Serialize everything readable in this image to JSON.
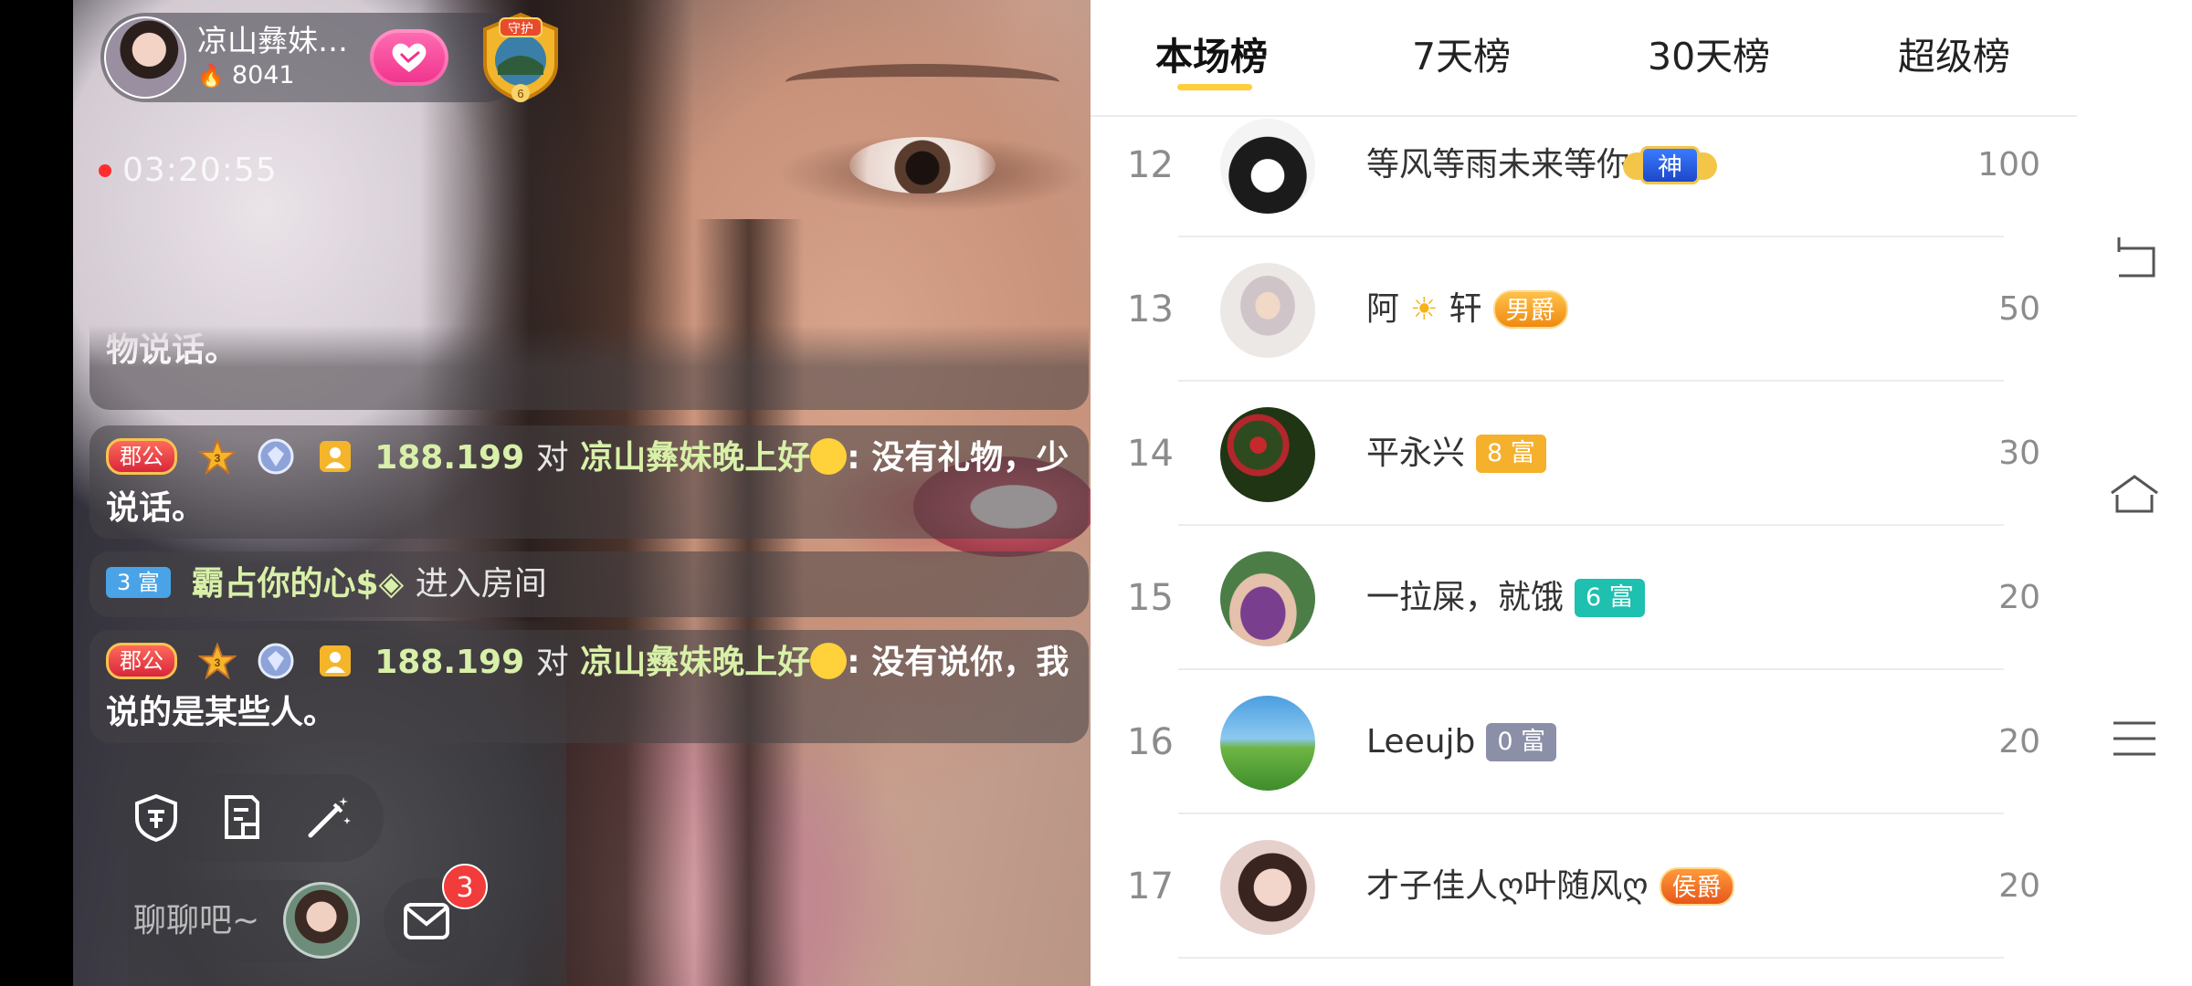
{
  "stream": {
    "host": {
      "name": "凉山彝妹…",
      "fans": "8041"
    },
    "guard_badge_text": "守护",
    "guard_badge_number": "6",
    "timer": "03:20:55",
    "chat": [
      {
        "tail": "物说话。"
      },
      {
        "tag": "郡公",
        "user": "188.199",
        "to": "对",
        "target": "凉山彝妹晚上好",
        "message": ": 没有礼物，少说话。"
      },
      {
        "tag": "3 富",
        "user": "霸占你的心$◈",
        "action": "进入房间"
      },
      {
        "tag": "郡公",
        "user": "188.199",
        "to": "对",
        "target": "凉山彝妹晚上好",
        "message": ": 没有说你，我说的是某些人。"
      }
    ],
    "input_placeholder": "聊聊吧~",
    "message_badge": "3"
  },
  "board": {
    "tabs": [
      {
        "label": "本场榜",
        "active": true
      },
      {
        "label": "7天榜",
        "active": false
      },
      {
        "label": "30天榜",
        "active": false
      },
      {
        "label": "超级榜",
        "active": false
      }
    ],
    "rows": [
      {
        "rank": "12",
        "name": "等风等雨未来等你",
        "badge": "神",
        "badge_type": "god",
        "score": "100"
      },
      {
        "rank": "13",
        "name_pre": "阿",
        "name_post": "轩",
        "badge": "男爵",
        "badge_type": "baron",
        "score": "50"
      },
      {
        "rank": "14",
        "name": "平永兴",
        "badge": "8 富",
        "badge_type": "fu8",
        "score": "30"
      },
      {
        "rank": "15",
        "name": "一拉屎，就饿",
        "badge": "6 富",
        "badge_type": "fu6",
        "score": "20"
      },
      {
        "rank": "16",
        "name": "Leeujb",
        "badge": "0 富",
        "badge_type": "fu0",
        "score": "20"
      },
      {
        "rank": "17",
        "name": "才子佳人ღ叶随风ღ",
        "badge": "侯爵",
        "badge_type": "marquis",
        "score": "20"
      }
    ]
  },
  "colors": {
    "accent_yellow": "#ffce3a",
    "live_red": "#ff2d2d",
    "follow_pink": "#f0318c"
  }
}
